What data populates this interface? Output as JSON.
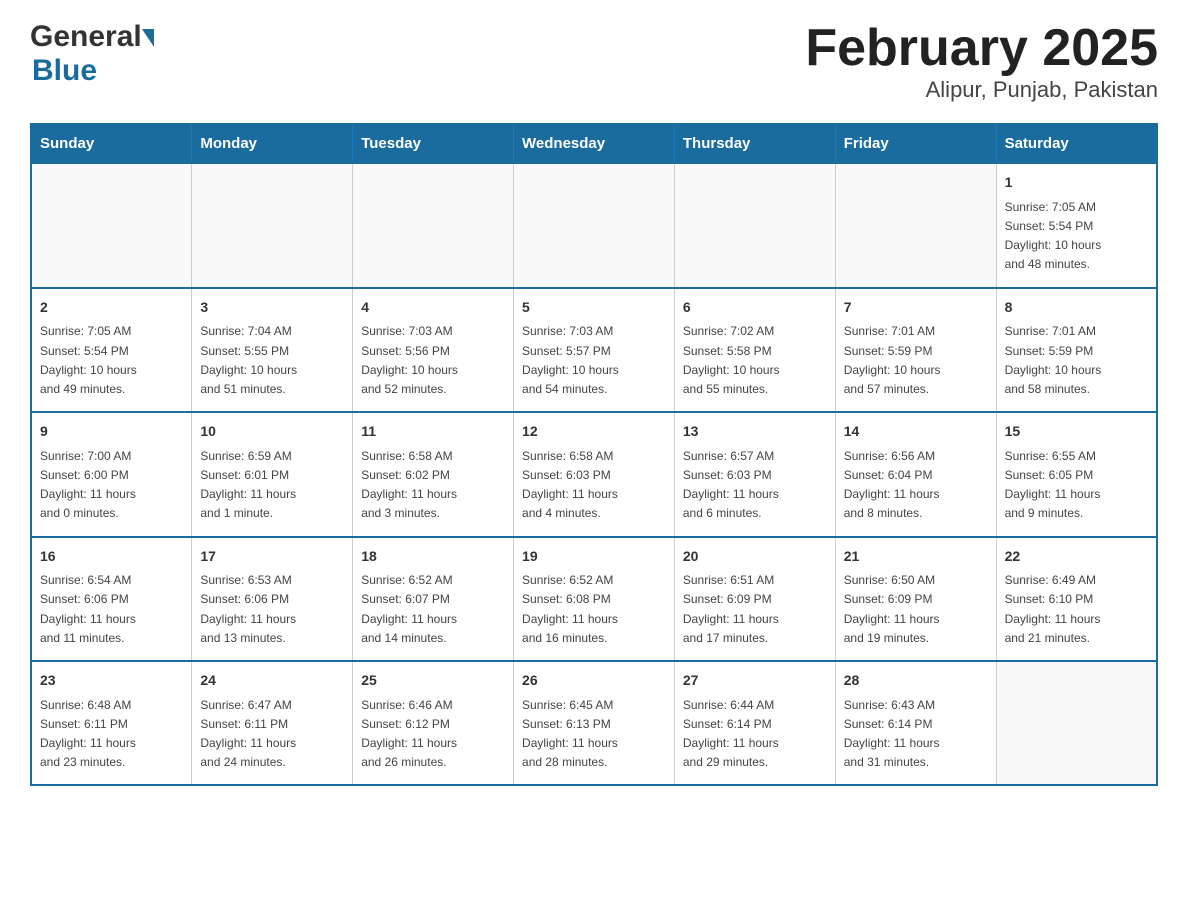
{
  "header": {
    "logo_general": "General",
    "logo_blue": "Blue",
    "month_title": "February 2025",
    "location": "Alipur, Punjab, Pakistan"
  },
  "weekdays": [
    "Sunday",
    "Monday",
    "Tuesday",
    "Wednesday",
    "Thursday",
    "Friday",
    "Saturday"
  ],
  "weeks": [
    [
      {
        "day": "",
        "info": ""
      },
      {
        "day": "",
        "info": ""
      },
      {
        "day": "",
        "info": ""
      },
      {
        "day": "",
        "info": ""
      },
      {
        "day": "",
        "info": ""
      },
      {
        "day": "",
        "info": ""
      },
      {
        "day": "1",
        "info": "Sunrise: 7:05 AM\nSunset: 5:54 PM\nDaylight: 10 hours\nand 48 minutes."
      }
    ],
    [
      {
        "day": "2",
        "info": "Sunrise: 7:05 AM\nSunset: 5:54 PM\nDaylight: 10 hours\nand 49 minutes."
      },
      {
        "day": "3",
        "info": "Sunrise: 7:04 AM\nSunset: 5:55 PM\nDaylight: 10 hours\nand 51 minutes."
      },
      {
        "day": "4",
        "info": "Sunrise: 7:03 AM\nSunset: 5:56 PM\nDaylight: 10 hours\nand 52 minutes."
      },
      {
        "day": "5",
        "info": "Sunrise: 7:03 AM\nSunset: 5:57 PM\nDaylight: 10 hours\nand 54 minutes."
      },
      {
        "day": "6",
        "info": "Sunrise: 7:02 AM\nSunset: 5:58 PM\nDaylight: 10 hours\nand 55 minutes."
      },
      {
        "day": "7",
        "info": "Sunrise: 7:01 AM\nSunset: 5:59 PM\nDaylight: 10 hours\nand 57 minutes."
      },
      {
        "day": "8",
        "info": "Sunrise: 7:01 AM\nSunset: 5:59 PM\nDaylight: 10 hours\nand 58 minutes."
      }
    ],
    [
      {
        "day": "9",
        "info": "Sunrise: 7:00 AM\nSunset: 6:00 PM\nDaylight: 11 hours\nand 0 minutes."
      },
      {
        "day": "10",
        "info": "Sunrise: 6:59 AM\nSunset: 6:01 PM\nDaylight: 11 hours\nand 1 minute."
      },
      {
        "day": "11",
        "info": "Sunrise: 6:58 AM\nSunset: 6:02 PM\nDaylight: 11 hours\nand 3 minutes."
      },
      {
        "day": "12",
        "info": "Sunrise: 6:58 AM\nSunset: 6:03 PM\nDaylight: 11 hours\nand 4 minutes."
      },
      {
        "day": "13",
        "info": "Sunrise: 6:57 AM\nSunset: 6:03 PM\nDaylight: 11 hours\nand 6 minutes."
      },
      {
        "day": "14",
        "info": "Sunrise: 6:56 AM\nSunset: 6:04 PM\nDaylight: 11 hours\nand 8 minutes."
      },
      {
        "day": "15",
        "info": "Sunrise: 6:55 AM\nSunset: 6:05 PM\nDaylight: 11 hours\nand 9 minutes."
      }
    ],
    [
      {
        "day": "16",
        "info": "Sunrise: 6:54 AM\nSunset: 6:06 PM\nDaylight: 11 hours\nand 11 minutes."
      },
      {
        "day": "17",
        "info": "Sunrise: 6:53 AM\nSunset: 6:06 PM\nDaylight: 11 hours\nand 13 minutes."
      },
      {
        "day": "18",
        "info": "Sunrise: 6:52 AM\nSunset: 6:07 PM\nDaylight: 11 hours\nand 14 minutes."
      },
      {
        "day": "19",
        "info": "Sunrise: 6:52 AM\nSunset: 6:08 PM\nDaylight: 11 hours\nand 16 minutes."
      },
      {
        "day": "20",
        "info": "Sunrise: 6:51 AM\nSunset: 6:09 PM\nDaylight: 11 hours\nand 17 minutes."
      },
      {
        "day": "21",
        "info": "Sunrise: 6:50 AM\nSunset: 6:09 PM\nDaylight: 11 hours\nand 19 minutes."
      },
      {
        "day": "22",
        "info": "Sunrise: 6:49 AM\nSunset: 6:10 PM\nDaylight: 11 hours\nand 21 minutes."
      }
    ],
    [
      {
        "day": "23",
        "info": "Sunrise: 6:48 AM\nSunset: 6:11 PM\nDaylight: 11 hours\nand 23 minutes."
      },
      {
        "day": "24",
        "info": "Sunrise: 6:47 AM\nSunset: 6:11 PM\nDaylight: 11 hours\nand 24 minutes."
      },
      {
        "day": "25",
        "info": "Sunrise: 6:46 AM\nSunset: 6:12 PM\nDaylight: 11 hours\nand 26 minutes."
      },
      {
        "day": "26",
        "info": "Sunrise: 6:45 AM\nSunset: 6:13 PM\nDaylight: 11 hours\nand 28 minutes."
      },
      {
        "day": "27",
        "info": "Sunrise: 6:44 AM\nSunset: 6:14 PM\nDaylight: 11 hours\nand 29 minutes."
      },
      {
        "day": "28",
        "info": "Sunrise: 6:43 AM\nSunset: 6:14 PM\nDaylight: 11 hours\nand 31 minutes."
      },
      {
        "day": "",
        "info": ""
      }
    ]
  ]
}
